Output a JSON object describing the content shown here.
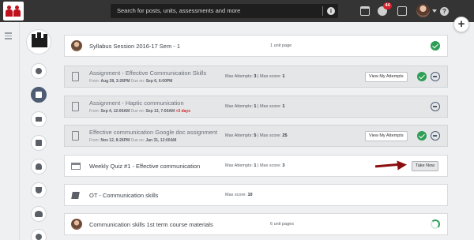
{
  "header": {
    "search_placeholder": "Search for posts, units, assessments and more",
    "notification_count": "44"
  },
  "sidebar": {
    "items": [
      "updates",
      "materials",
      "courses",
      "grades",
      "profile",
      "badges",
      "groups",
      "info"
    ],
    "active": "materials"
  },
  "rows": [
    {
      "title": "Syllabus Session 2016-17 Sem - 1",
      "meta": "1 unit page",
      "status": "complete"
    },
    {
      "title": "Assignment - Effective Communication Skills",
      "from_label": "From:",
      "from": "Aug 28, 3:26PM",
      "due_label": "Due on:",
      "due": "Sep 6, 6:00PM",
      "max_attempts_label": "Max Attempts:",
      "max_attempts": "3",
      "max_score_label": "Max score:",
      "max_score": "1",
      "button": "View My Attempts",
      "status": "complete"
    },
    {
      "title": "Assignment - Haptic communication",
      "from_label": "From:",
      "from": "Sep 4, 12:00AM",
      "due_label": "Due on:",
      "due": "Sep 13, 7:00AM",
      "late": "+3 days",
      "max_attempts_label": "Max Attempts:",
      "max_attempts": "1",
      "max_score_label": "Max score:",
      "max_score": "1",
      "status": "not-started"
    },
    {
      "title": "Effective communication Google doc assignment",
      "from_label": "From:",
      "from": "Nov 12, 8:26PM",
      "due_label": "Due on:",
      "due": "Jan 31, 12:00AM",
      "max_attempts_label": "Max Attempts:",
      "max_attempts": "5",
      "max_score_label": "Max score:",
      "max_score": "25",
      "button": "View My Attempts",
      "status": "complete"
    },
    {
      "title": "Weekly Quiz #1 - Effective communication",
      "max_attempts_label": "Max Attempts:",
      "max_attempts": "1",
      "max_score_label": "Max score:",
      "max_score": "3",
      "button": "Take Now"
    },
    {
      "title": "OT - Communication skills",
      "max_score_label": "Max score:",
      "max_score": "10"
    },
    {
      "title": "Communication skills 1st term course materials",
      "meta": "6 unit pages",
      "status": "in-progress"
    }
  ],
  "colors": {
    "topbar": "#343434",
    "accent_active": "#4d5c73",
    "complete": "#2e9e57",
    "annotation_arrow": "#8b0d0d",
    "late": "#d12a2a"
  }
}
